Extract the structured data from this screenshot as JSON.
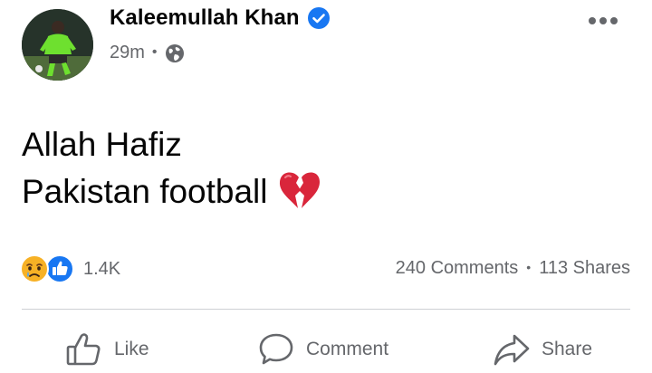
{
  "post": {
    "author": "Kaleemullah Khan",
    "verified": true,
    "time": "29m",
    "meta_separator": "•",
    "audience_icon": "globe-icon",
    "more_icon": "more-options-icon",
    "text_lines": [
      "Allah Hafiz",
      "Pakistan football"
    ],
    "text_emoji": "broken-heart-icon"
  },
  "reactions": {
    "icons": [
      "sad-reaction-icon",
      "like-reaction-icon"
    ],
    "count": "1.4K"
  },
  "stats": {
    "comments": "240 Comments",
    "separator": "•",
    "shares": "113 Shares"
  },
  "actions": {
    "like": "Like",
    "comment": "Comment",
    "share": "Share"
  },
  "colors": {
    "verified_blue": "#1877f2",
    "secondary_text": "#65676b",
    "broken_heart": "#d9263b",
    "sad_face": "#f7b125"
  }
}
